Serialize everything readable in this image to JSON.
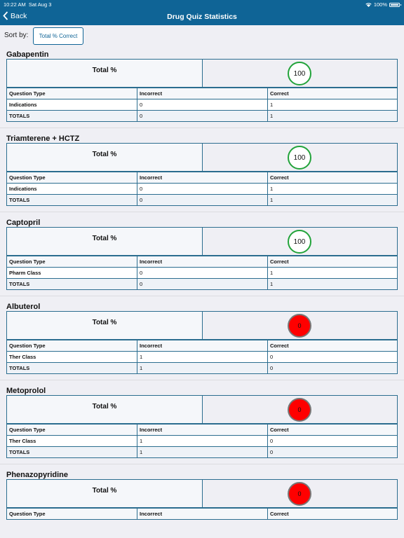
{
  "status": {
    "time": "10:22 AM",
    "date": "Sat Aug 3",
    "battery": "100%"
  },
  "nav": {
    "back_label": "Back",
    "title": "Drug Quiz Statistics"
  },
  "sort": {
    "label": "Sort by:",
    "value": "Total % Correct"
  },
  "columns": {
    "question_type": "Question Type",
    "incorrect": "Incorrect",
    "correct": "Correct"
  },
  "summary_label": "Total %",
  "drugs": [
    {
      "name": "Gabapentin",
      "score": "100",
      "result": "pass",
      "rows": [
        {
          "type": "Indications",
          "incorrect": "0",
          "correct": "1"
        },
        {
          "type": "TOTALS",
          "incorrect": "0",
          "correct": "1"
        }
      ]
    },
    {
      "name": "Triamterene + HCTZ",
      "score": "100",
      "result": "pass",
      "rows": [
        {
          "type": "Indications",
          "incorrect": "0",
          "correct": "1"
        },
        {
          "type": "TOTALS",
          "incorrect": "0",
          "correct": "1"
        }
      ]
    },
    {
      "name": "Captopril",
      "score": "100",
      "result": "pass",
      "rows": [
        {
          "type": "Pharm Class",
          "incorrect": "0",
          "correct": "1"
        },
        {
          "type": "TOTALS",
          "incorrect": "0",
          "correct": "1"
        }
      ]
    },
    {
      "name": "Albuterol",
      "score": "0",
      "result": "fail",
      "rows": [
        {
          "type": "Ther Class",
          "incorrect": "1",
          "correct": "0"
        },
        {
          "type": "TOTALS",
          "incorrect": "1",
          "correct": "0"
        }
      ]
    },
    {
      "name": "Metoprolol",
      "score": "0",
      "result": "fail",
      "rows": [
        {
          "type": "Ther Class",
          "incorrect": "1",
          "correct": "0"
        },
        {
          "type": "TOTALS",
          "incorrect": "1",
          "correct": "0"
        }
      ]
    },
    {
      "name": "Phenazopyridine",
      "score": "0",
      "result": "fail",
      "rows": []
    }
  ],
  "colors": {
    "nav_bg": "#0f6496",
    "pass_ring": "#22a33a",
    "fail_fill": "#ff0000",
    "border": "#2b6d8f"
  }
}
